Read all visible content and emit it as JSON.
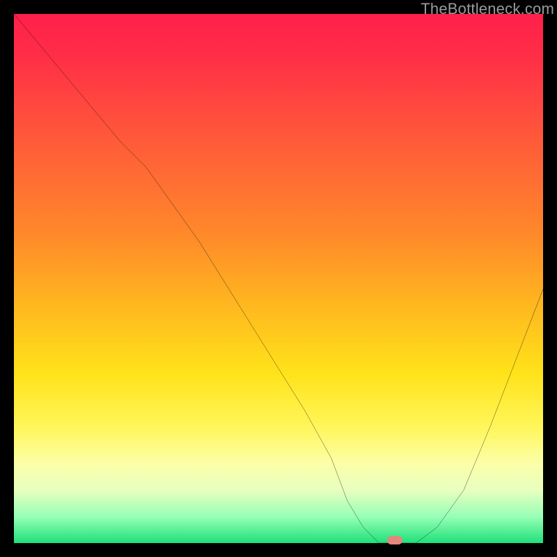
{
  "watermark": "TheBottleneck.com",
  "accent_colors": {
    "curve": "#000000",
    "marker": "#e6857e",
    "gradient_top": "#ff1f4a",
    "gradient_bottom": "#1fe07a"
  },
  "chart_data": {
    "type": "line",
    "title": "",
    "xlabel": "",
    "ylabel": "",
    "xlim": [
      0,
      100
    ],
    "ylim": [
      0,
      100
    ],
    "x": [
      0,
      5,
      10,
      15,
      20,
      25,
      30,
      35,
      40,
      45,
      50,
      55,
      60,
      63,
      66,
      69,
      72,
      76,
      80,
      85,
      90,
      95,
      100
    ],
    "values": [
      100,
      94,
      88,
      82,
      76,
      71,
      64,
      57,
      49,
      41,
      33,
      25,
      16,
      8,
      3,
      0,
      0,
      0,
      3,
      10,
      22,
      35,
      48
    ],
    "marker": {
      "x": 72,
      "y": 0
    },
    "note": "Axes have no tick labels in the source image; x and y are normalized 0–100. y=0 is the bottom (green) edge, y=100 is the top (red) edge."
  }
}
